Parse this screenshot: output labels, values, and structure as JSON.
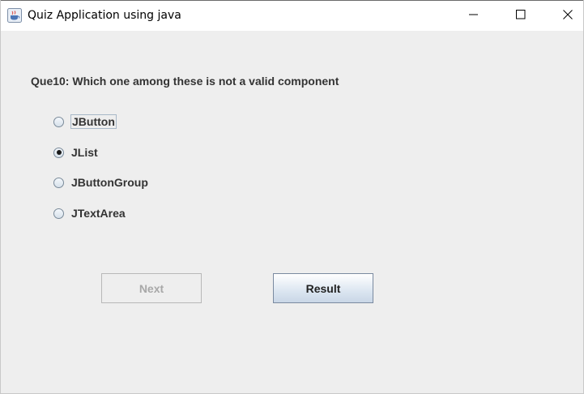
{
  "window": {
    "title": "Quiz Application using java",
    "icon": "java-cup-icon"
  },
  "controls": {
    "minimize": "minimize-icon",
    "maximize": "maximize-icon",
    "close": "close-icon"
  },
  "quiz": {
    "question": "Que10: Which one among these is not a valid component",
    "options": [
      {
        "label": "JButton",
        "selected": false
      },
      {
        "label": "JList",
        "selected": true
      },
      {
        "label": "JButtonGroup",
        "selected": false
      },
      {
        "label": "JTextArea",
        "selected": false
      }
    ]
  },
  "buttons": {
    "next_label": "Next",
    "next_enabled": false,
    "result_label": "Result",
    "result_enabled": true
  }
}
